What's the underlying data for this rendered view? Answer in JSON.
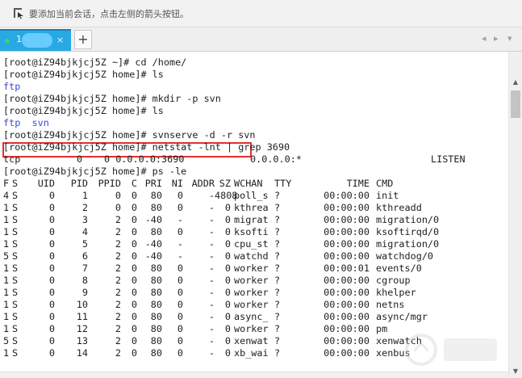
{
  "hint_bar": {
    "text": "要添加当前会话，点击左侧的箭头按钮。",
    "icon": "pin-arrow-icon"
  },
  "tabs": [
    {
      "label": "1",
      "close": "×",
      "status_color": "#3cd070"
    }
  ],
  "tab_bar": {
    "add_label": "+",
    "prev": "◂",
    "next": "▸",
    "menu": "▾"
  },
  "terminal": {
    "lines": [
      {
        "text": "[root@iZ94bjkjcj5Z ~]# cd /home/"
      },
      {
        "text": "[root@iZ94bjkjcj5Z home]# ls"
      },
      {
        "text": "ftp",
        "color": "#3b4bd4"
      },
      {
        "text": "[root@iZ94bjkjcj5Z home]# mkdir -p svn"
      },
      {
        "text": "[root@iZ94bjkjcj5Z home]# ls"
      },
      {
        "text": "ftp  svn",
        "color": "#3b4bd4"
      },
      {
        "text": "[root@iZ94bjkjcj5Z home]# svnserve -d -r svn"
      },
      {
        "text": "[root@iZ94bjkjcj5Z home]# netstat -lnt | grep 3690"
      }
    ],
    "netstat_row": [
      "tcp",
      "0",
      "0 0.0.0.0:3690",
      "0.0.0.0:*",
      "LISTEN"
    ],
    "ps_prompt": "[root@iZ94bjkjcj5Z home]# ps -le",
    "ps_headers": [
      "F",
      "S",
      "UID",
      "PID",
      "PPID",
      "C",
      "PRI",
      "NI",
      "ADDR",
      "SZ",
      "WCHAN",
      "TTY",
      "TIME",
      "CMD"
    ],
    "ps_rows": [
      [
        "4",
        "S",
        "0",
        "1",
        "0",
        "0",
        "80",
        "0",
        "-",
        "4808",
        "poll_s",
        "?",
        "00:00:00",
        "init"
      ],
      [
        "1",
        "S",
        "0",
        "2",
        "0",
        "0",
        "80",
        "0",
        "-",
        "0",
        "kthrea",
        "?",
        "00:00:00",
        "kthreadd"
      ],
      [
        "1",
        "S",
        "0",
        "3",
        "2",
        "0",
        "-40",
        "-",
        "-",
        "0",
        "migrat",
        "?",
        "00:00:00",
        "migration/0"
      ],
      [
        "1",
        "S",
        "0",
        "4",
        "2",
        "0",
        "80",
        "0",
        "-",
        "0",
        "ksofti",
        "?",
        "00:00:00",
        "ksoftirqd/0"
      ],
      [
        "1",
        "S",
        "0",
        "5",
        "2",
        "0",
        "-40",
        "-",
        "-",
        "0",
        "cpu_st",
        "?",
        "00:00:00",
        "migration/0"
      ],
      [
        "5",
        "S",
        "0",
        "6",
        "2",
        "0",
        "-40",
        "-",
        "-",
        "0",
        "watchd",
        "?",
        "00:00:00",
        "watchdog/0"
      ],
      [
        "1",
        "S",
        "0",
        "7",
        "2",
        "0",
        "80",
        "0",
        "-",
        "0",
        "worker",
        "?",
        "00:00:01",
        "events/0"
      ],
      [
        "1",
        "S",
        "0",
        "8",
        "2",
        "0",
        "80",
        "0",
        "-",
        "0",
        "worker",
        "?",
        "00:00:00",
        "cgroup"
      ],
      [
        "1",
        "S",
        "0",
        "9",
        "2",
        "0",
        "80",
        "0",
        "-",
        "0",
        "worker",
        "?",
        "00:00:00",
        "khelper"
      ],
      [
        "1",
        "S",
        "0",
        "10",
        "2",
        "0",
        "80",
        "0",
        "-",
        "0",
        "worker",
        "?",
        "00:00:00",
        "netns"
      ],
      [
        "1",
        "S",
        "0",
        "11",
        "2",
        "0",
        "80",
        "0",
        "-",
        "0",
        "async_",
        "?",
        "00:00:00",
        "async/mgr"
      ],
      [
        "1",
        "S",
        "0",
        "12",
        "2",
        "0",
        "80",
        "0",
        "-",
        "0",
        "worker",
        "?",
        "00:00:00",
        "pm"
      ],
      [
        "5",
        "S",
        "0",
        "13",
        "2",
        "0",
        "80",
        "0",
        "-",
        "0",
        "xenwat",
        "?",
        "00:00:00",
        "xenwatch"
      ],
      [
        "1",
        "S",
        "0",
        "14",
        "2",
        "0",
        "80",
        "0",
        "-",
        "0",
        "xb_wai",
        "?",
        "00:00:00",
        "xenbus"
      ]
    ],
    "highlight_color": "#e03030"
  },
  "scrollbar": {
    "up": "▲",
    "down": "▼"
  },
  "colors": {
    "tab_active": "#28a9e4",
    "prompt_text": "#1e1e1e",
    "dir_blue": "#3b4bd4"
  }
}
